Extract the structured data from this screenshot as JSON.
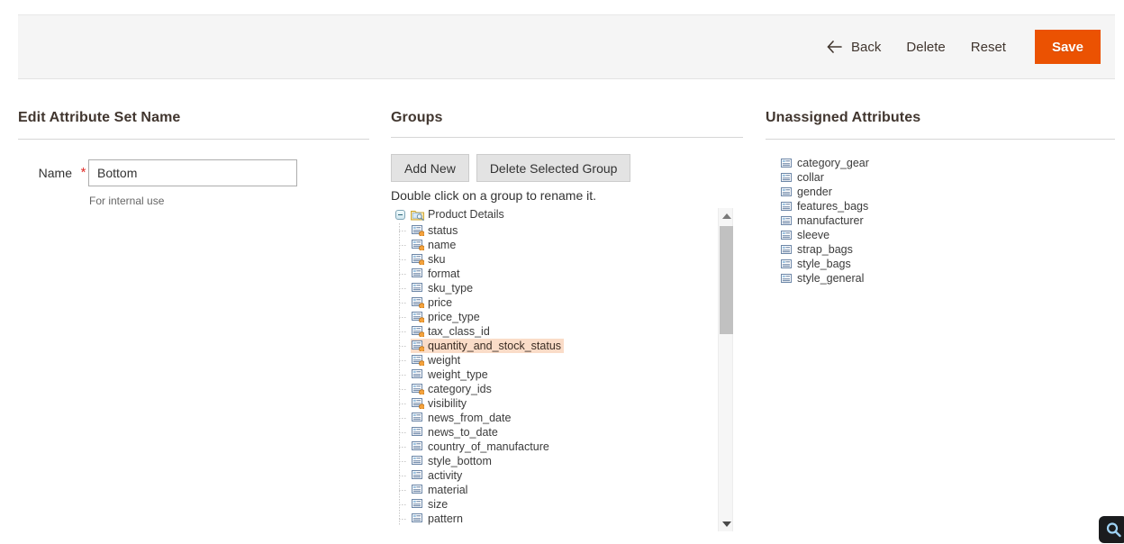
{
  "page_actions": {
    "back_label": "Back",
    "delete_label": "Delete",
    "reset_label": "Reset",
    "save_label": "Save",
    "save_color": "#eb5202"
  },
  "left_panel": {
    "title": "Edit Attribute Set Name",
    "name_label": "Name",
    "required_marker": "*",
    "name_value": "Bottom",
    "name_placeholder": "",
    "name_note": "For internal use"
  },
  "groups_panel": {
    "title": "Groups",
    "add_new_label": "Add New",
    "delete_group_label": "Delete Selected Group",
    "hint": "Double click on a group to rename it.",
    "tree": {
      "root": {
        "label": "Product Details",
        "icon": "folder-search-icon",
        "expanded": true
      },
      "children": [
        {
          "label": "status",
          "icon": "attribute-system-icon",
          "system": true,
          "selected": false
        },
        {
          "label": "name",
          "icon": "attribute-system-icon",
          "system": true,
          "selected": false
        },
        {
          "label": "sku",
          "icon": "attribute-system-icon",
          "system": true,
          "selected": false
        },
        {
          "label": "format",
          "icon": "attribute-icon",
          "system": false,
          "selected": false
        },
        {
          "label": "sku_type",
          "icon": "attribute-icon",
          "system": false,
          "selected": false
        },
        {
          "label": "price",
          "icon": "attribute-system-icon",
          "system": true,
          "selected": false
        },
        {
          "label": "price_type",
          "icon": "attribute-system-icon",
          "system": true,
          "selected": false
        },
        {
          "label": "tax_class_id",
          "icon": "attribute-system-icon",
          "system": true,
          "selected": false
        },
        {
          "label": "quantity_and_stock_status",
          "icon": "attribute-system-icon",
          "system": true,
          "selected": true
        },
        {
          "label": "weight",
          "icon": "attribute-system-icon",
          "system": true,
          "selected": false
        },
        {
          "label": "weight_type",
          "icon": "attribute-icon",
          "system": false,
          "selected": false
        },
        {
          "label": "category_ids",
          "icon": "attribute-system-icon",
          "system": true,
          "selected": false
        },
        {
          "label": "visibility",
          "icon": "attribute-system-icon",
          "system": true,
          "selected": false
        },
        {
          "label": "news_from_date",
          "icon": "attribute-icon",
          "system": false,
          "selected": false
        },
        {
          "label": "news_to_date",
          "icon": "attribute-icon",
          "system": false,
          "selected": false
        },
        {
          "label": "country_of_manufacture",
          "icon": "attribute-icon",
          "system": false,
          "selected": false
        },
        {
          "label": "style_bottom",
          "icon": "attribute-icon",
          "system": false,
          "selected": false
        },
        {
          "label": "activity",
          "icon": "attribute-icon",
          "system": false,
          "selected": false
        },
        {
          "label": "material",
          "icon": "attribute-icon",
          "system": false,
          "selected": false
        },
        {
          "label": "size",
          "icon": "attribute-icon",
          "system": false,
          "selected": false
        },
        {
          "label": "pattern",
          "icon": "attribute-icon",
          "system": false,
          "selected": false
        }
      ],
      "selected_highlight_color": "#fadcc8"
    },
    "scrollbar": {
      "up_icon": "caret-up-icon",
      "down_icon": "caret-down-icon",
      "thumb_position_pct": 5
    }
  },
  "unassigned_panel": {
    "title": "Unassigned Attributes",
    "items": [
      {
        "label": "category_gear",
        "icon": "attribute-icon"
      },
      {
        "label": "collar",
        "icon": "attribute-icon"
      },
      {
        "label": "gender",
        "icon": "attribute-icon"
      },
      {
        "label": "features_bags",
        "icon": "attribute-icon"
      },
      {
        "label": "manufacturer",
        "icon": "attribute-icon"
      },
      {
        "label": "sleeve",
        "icon": "attribute-icon"
      },
      {
        "label": "strap_bags",
        "icon": "attribute-icon"
      },
      {
        "label": "style_bags",
        "icon": "attribute-icon"
      },
      {
        "label": "style_general",
        "icon": "attribute-icon"
      }
    ]
  },
  "corner_widget": {
    "icon": "magnifier-icon"
  }
}
